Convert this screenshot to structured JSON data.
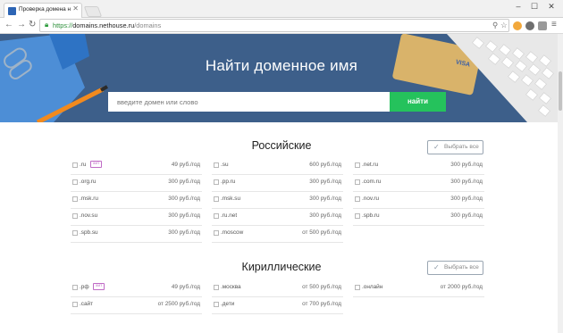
{
  "browser": {
    "tab_title": "Проверка домена на зан",
    "url_secure": "https://",
    "url_host": "domains.nethouse.ru",
    "url_path": "/domains"
  },
  "hero": {
    "title": "Найти доменное имя",
    "search_placeholder": "введите домен или слово",
    "search_button": "найти"
  },
  "sections": [
    {
      "title": "Российские",
      "select_all": "Выбрать все",
      "columns": [
        [
          {
            "zone": ".ru",
            "badge": "хит",
            "price": "49 руб./год"
          },
          {
            "zone": ".org.ru",
            "price": "300 руб./год"
          },
          {
            "zone": ".msk.ru",
            "price": "300 руб./год"
          },
          {
            "zone": ".nov.su",
            "price": "300 руб./год"
          },
          {
            "zone": ".spb.su",
            "price": "300 руб./год"
          }
        ],
        [
          {
            "zone": ".su",
            "price": "600 руб./год"
          },
          {
            "zone": ".pp.ru",
            "price": "300 руб./год"
          },
          {
            "zone": ".msk.su",
            "price": "300 руб./год"
          },
          {
            "zone": ".ru.net",
            "price": "300 руб./год"
          },
          {
            "zone": ".moscow",
            "price": "от 500 руб./год"
          }
        ],
        [
          {
            "zone": ".net.ru",
            "price": "300 руб./год"
          },
          {
            "zone": ".com.ru",
            "price": "300 руб./год"
          },
          {
            "zone": ".nov.ru",
            "price": "300 руб./год"
          },
          {
            "zone": ".spb.ru",
            "price": "300 руб./год"
          }
        ]
      ]
    },
    {
      "title": "Кириллические",
      "select_all": "Выбрать все",
      "columns": [
        [
          {
            "zone": ".рф",
            "badge": "хит",
            "price": "49 руб./год"
          },
          {
            "zone": ".сайт",
            "price": "от 2500 руб./год"
          }
        ],
        [
          {
            "zone": ".москва",
            "price": "от 500 руб./год"
          },
          {
            "zone": ".дети",
            "price": "от 700 руб./год"
          }
        ],
        [
          {
            "zone": ".онлайн",
            "price": "от 2000 руб./год"
          }
        ]
      ]
    }
  ],
  "colors": {
    "hero_bg": "#3d5f8a",
    "search_button": "#25c25c",
    "badge": "#c06bc6",
    "secure_url": "#2a8f38"
  }
}
